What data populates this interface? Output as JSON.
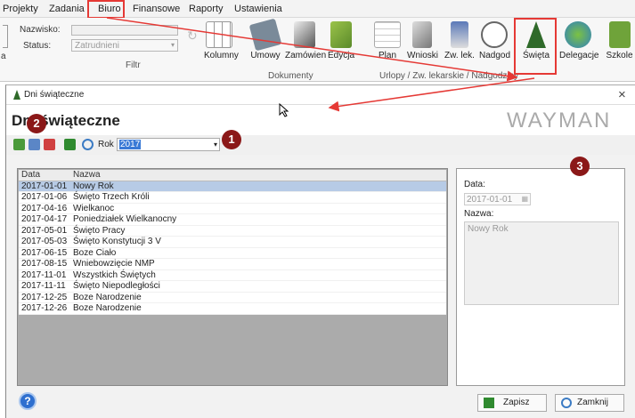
{
  "menubar": {
    "items": [
      "Projekty",
      "Zadania",
      "Biuro",
      "Finansowe",
      "Raporty",
      "Ustawienia"
    ]
  },
  "ribbon": {
    "nazwisko_label": "Nazwisko:",
    "status_label": "Status:",
    "status_value": "Zatrudnieni",
    "filtr_label": "Filtr",
    "a_label": "a",
    "kolumny_label": "Kolumny",
    "dokumenty_group": "Dokumenty",
    "urlopy_group": "Urlopy / Zw. lekarskie / Nadgodziny",
    "buttons": {
      "umowy": "Umowy",
      "zamowien": "Zamówien",
      "edycja": "Edycja",
      "plan": "Plan",
      "wnioski": "Wnioski",
      "zwlek": "Zw. lek.",
      "nadgod": "Nadgod",
      "swieta": "Święta",
      "delegacje": "Delegacje",
      "szkole": "Szkole"
    }
  },
  "window": {
    "title": "Dni świąteczne",
    "close": "×",
    "heading": "Dni świąteczne",
    "brand": "WAYMAN",
    "rok_label": "Rok",
    "rok_value": "2017"
  },
  "table": {
    "headers": {
      "date": "Data",
      "name": "Nazwa"
    },
    "rows": [
      {
        "date": "2017-01-01",
        "name": "Nowy Rok"
      },
      {
        "date": "2017-01-06",
        "name": "Święto Trzech Króli"
      },
      {
        "date": "2017-04-16",
        "name": "Wielkanoc"
      },
      {
        "date": "2017-04-17",
        "name": "Poniedziałek Wielkanocny"
      },
      {
        "date": "2017-05-01",
        "name": "Święto Pracy"
      },
      {
        "date": "2017-05-03",
        "name": "Święto Konstytucji 3 V"
      },
      {
        "date": "2017-06-15",
        "name": "Boze Ciało"
      },
      {
        "date": "2017-08-15",
        "name": "Wniebowzięcie NMP"
      },
      {
        "date": "2017-11-01",
        "name": "Wszystkich Świętych"
      },
      {
        "date": "2017-11-11",
        "name": "Święto Niepodległości"
      },
      {
        "date": "2017-12-25",
        "name": "Boze Narodzenie"
      },
      {
        "date": "2017-12-26",
        "name": "Boze Narodzenie"
      }
    ]
  },
  "detail": {
    "date_label": "Data:",
    "date_value": "2017-01-01",
    "name_label": "Nazwa:",
    "name_value": "Nowy Rok"
  },
  "footer": {
    "save": "Zapisz",
    "close": "Zamknij",
    "help": "?"
  },
  "badges": [
    "1",
    "2",
    "3"
  ],
  "colors": {
    "accent_red": "#e53935",
    "badge": "#8b1818",
    "selected_row": "#b7cbe6"
  }
}
